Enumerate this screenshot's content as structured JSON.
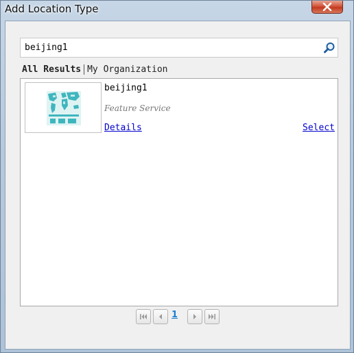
{
  "window": {
    "title": "Add Location Type",
    "close_icon": "close-icon"
  },
  "search": {
    "value": "beijing1",
    "icon": "search-icon"
  },
  "tabs": [
    {
      "label": "All Results",
      "active": true
    },
    {
      "label": "My Organization",
      "active": false
    }
  ],
  "results": [
    {
      "title": "beijing1",
      "type": "Feature Service",
      "details_label": "Details",
      "select_label": "Select",
      "thumbnail": "world-map-thumbnail"
    }
  ],
  "pager": {
    "current_page": "1",
    "icons": [
      "first-page-icon",
      "prev-page-icon",
      "next-page-icon",
      "last-page-icon"
    ]
  },
  "colors": {
    "link": "#0000cc",
    "page_link": "#1a7fd0",
    "close_button": "#c23a1f"
  }
}
